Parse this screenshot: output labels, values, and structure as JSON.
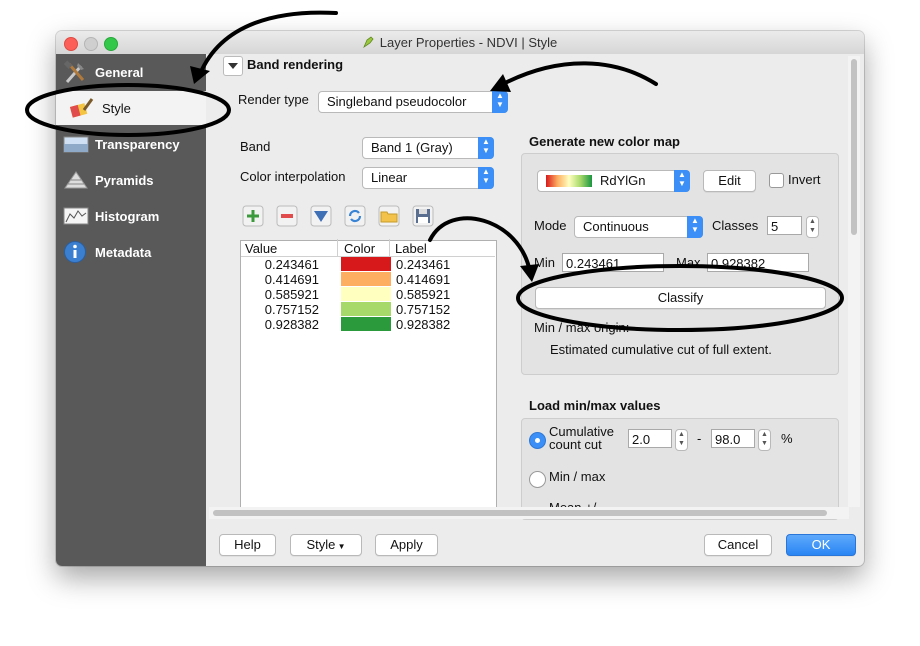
{
  "window": {
    "title": "Layer Properties - NDVI | Style"
  },
  "sidebar": {
    "items": [
      {
        "label": "General",
        "icon": "wrench-hammer-icon"
      },
      {
        "label": "Style",
        "icon": "paintbrush-icon"
      },
      {
        "label": "Transparency",
        "icon": "transparency-icon"
      },
      {
        "label": "Pyramids",
        "icon": "pyramid-icon"
      },
      {
        "label": "Histogram",
        "icon": "histogram-icon"
      },
      {
        "label": "Metadata",
        "icon": "info-icon"
      }
    ],
    "selected": "Style"
  },
  "section": {
    "title": "Band rendering"
  },
  "render_type": {
    "label": "Render type",
    "value": "Singleband pseudocolor"
  },
  "band": {
    "label": "Band",
    "value": "Band 1 (Gray)"
  },
  "interpolation": {
    "label": "Color interpolation",
    "value": "Linear"
  },
  "toolbar_icons": [
    "add-icon",
    "remove-icon",
    "down-arrow-icon",
    "refresh-icon",
    "folder-icon",
    "save-icon"
  ],
  "table": {
    "headers": [
      "Value",
      "Color",
      "Label"
    ],
    "rows": [
      {
        "value": "0.243461",
        "color": "#d7191c",
        "label": "0.243461"
      },
      {
        "value": "0.414691",
        "color": "#fdae61",
        "label": "0.414691"
      },
      {
        "value": "0.585921",
        "color": "#ffffbf",
        "label": "0.585921"
      },
      {
        "value": "0.757152",
        "color": "#a6d96a",
        "label": "0.757152"
      },
      {
        "value": "0.928382",
        "color": "#2b9a3d",
        "label": "0.928382"
      }
    ]
  },
  "color_map": {
    "title": "Generate new color map",
    "ramp": "RdYlGn",
    "edit_label": "Edit",
    "invert_label": "Invert",
    "mode_label": "Mode",
    "mode_value": "Continuous",
    "classes_label": "Classes",
    "classes_value": "5",
    "min_label": "Min",
    "min_value": "0.243461",
    "max_label": "Max",
    "max_value": "0.928382",
    "classify_label": "Classify",
    "origin_label": "Min / max origin:",
    "origin_value": "Estimated cumulative cut of full extent."
  },
  "minmax": {
    "title": "Load min/max values",
    "cumulative_label_1": "Cumulative",
    "cumulative_label_2": "count cut",
    "cut_min": "2.0",
    "dash": "-",
    "cut_max": "98.0",
    "percent": "%",
    "minmax_label": "Min / max",
    "partial_label": "Mean +/-"
  },
  "footer": {
    "help": "Help",
    "style": "Style",
    "apply": "Apply",
    "cancel": "Cancel",
    "ok": "OK"
  },
  "colors": {
    "accent": "#3b8ff6",
    "sidebar": "#595959"
  }
}
